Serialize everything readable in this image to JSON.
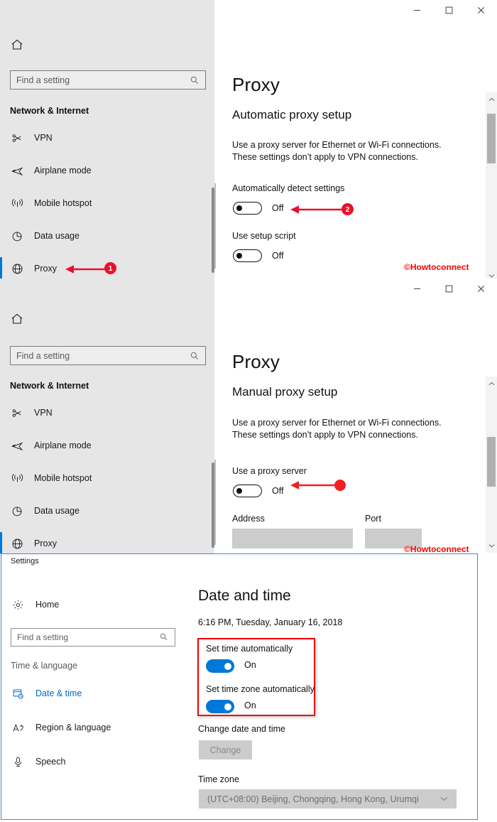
{
  "windows": {
    "proxy_auto": {
      "titlebar": {
        "minimize": "—",
        "maximize": "□",
        "close": "✕"
      },
      "sidebar": {
        "home_icon": "home-icon",
        "search": {
          "placeholder": "Find a setting",
          "value": "",
          "icon": "search-icon"
        },
        "group_title": "Network & Internet",
        "items": [
          {
            "label": "VPN",
            "icon": "vpn-icon",
            "selected": false
          },
          {
            "label": "Airplane mode",
            "icon": "airplane-icon",
            "selected": false
          },
          {
            "label": "Mobile hotspot",
            "icon": "hotspot-icon",
            "selected": false
          },
          {
            "label": "Data usage",
            "icon": "data-usage-icon",
            "selected": false
          },
          {
            "label": "Proxy",
            "icon": "globe-icon",
            "selected": true
          }
        ]
      },
      "content": {
        "page_title": "Proxy",
        "section_heading": "Automatic proxy setup",
        "description_line1": "Use a proxy server for Ethernet or Wi-Fi connections.",
        "description_line2": "These settings don’t apply to VPN connections.",
        "settings": [
          {
            "label": "Automatically detect settings",
            "state": "Off"
          },
          {
            "label": "Use setup script",
            "state": "Off"
          }
        ],
        "watermark": "©Howtoconnect"
      },
      "annotations": [
        {
          "id": "1",
          "target": "sidebar-item-proxy"
        },
        {
          "id": "2",
          "target": "automatically-detect-settings-toggle"
        }
      ]
    },
    "proxy_manual": {
      "titlebar": {
        "minimize": "—",
        "maximize": "□",
        "close": "✕"
      },
      "sidebar": {
        "home_icon": "home-icon",
        "search": {
          "placeholder": "Find a setting",
          "value": "",
          "icon": "search-icon"
        },
        "group_title": "Network & Internet",
        "items": [
          {
            "label": "VPN",
            "icon": "vpn-icon",
            "selected": false
          },
          {
            "label": "Airplane mode",
            "icon": "airplane-icon",
            "selected": false
          },
          {
            "label": "Mobile hotspot",
            "icon": "hotspot-icon",
            "selected": false
          },
          {
            "label": "Data usage",
            "icon": "data-usage-icon",
            "selected": false
          },
          {
            "label": "Proxy",
            "icon": "globe-icon",
            "selected": true
          }
        ]
      },
      "content": {
        "page_title": "Proxy",
        "section_heading": "Manual proxy setup",
        "description_line1": "Use a proxy server for Ethernet or Wi-Fi connections.",
        "description_line2": "These settings don’t apply to VPN connections.",
        "toggle_label": "Use a proxy server",
        "toggle_state": "Off",
        "address_label": "Address",
        "address_value": "",
        "port_label": "Port",
        "port_value": "",
        "watermark": "©Howtoconnect"
      }
    },
    "datetime": {
      "window_title": "Settings",
      "sidebar": {
        "home_label": "Home",
        "home_icon": "gear-icon",
        "search": {
          "placeholder": "Find a setting",
          "value": "",
          "icon": "search-icon"
        },
        "group_title": "Time & language",
        "items": [
          {
            "label": "Date & time",
            "icon": "calendar-clock-icon",
            "active": true
          },
          {
            "label": "Region & language",
            "icon": "language-icon",
            "active": false
          },
          {
            "label": "Speech",
            "icon": "microphone-icon",
            "active": false
          }
        ]
      },
      "content": {
        "page_title": "Date and time",
        "current_datetime": "6:16 PM, Tuesday, January 16, 2018",
        "set_time_label": "Set time automatically",
        "set_time_state": "On",
        "set_timezone_label": "Set time zone automatically",
        "set_timezone_state": "On",
        "change_section_label": "Change date and time",
        "change_button": "Change",
        "timezone_label": "Time zone",
        "timezone_value": "(UTC+08:00) Beijing, Chongqing, Hong Kong, Urumqi",
        "timezone_chevron": "⌄"
      }
    }
  },
  "colors": {
    "accent_blue": "#0078d7",
    "annotation_red": "#e8112d",
    "sidebar_bg": "#e6e6e6",
    "highlight_box": "#ef0000",
    "watermark_red": "#ff0000"
  }
}
